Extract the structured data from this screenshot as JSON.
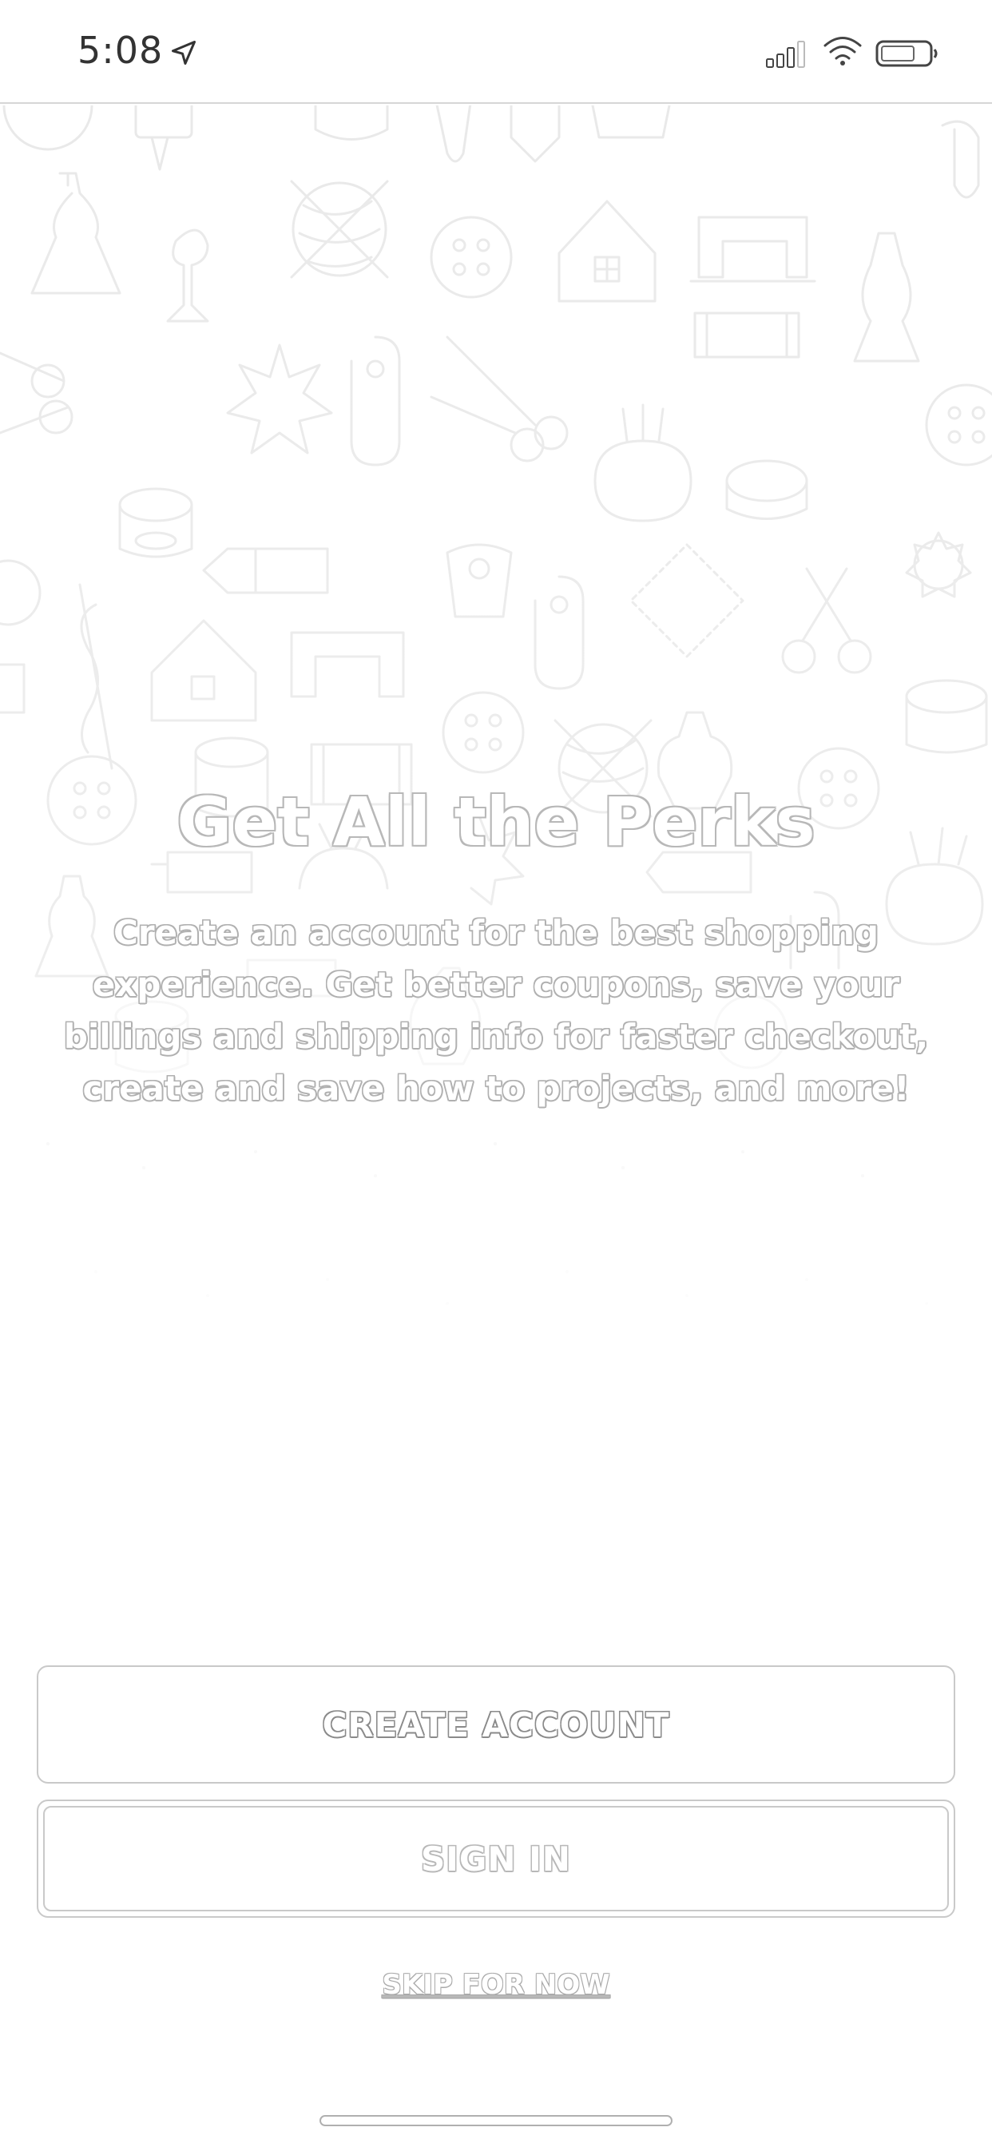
{
  "status_bar": {
    "time": "5:08",
    "icons": [
      "location-arrow-icon",
      "cellular-signal-icon",
      "wifi-icon",
      "battery-icon"
    ]
  },
  "background": {
    "pattern_icons": [
      "dress-form-icon",
      "yarn-ball-icon",
      "button-icon",
      "house-icon",
      "spool-icon",
      "scissors-icon",
      "safety-pin-icon",
      "pincushion-icon",
      "sewing-machine-icon",
      "fabric-roll-icon",
      "ruler-icon",
      "star-badge-icon"
    ]
  },
  "onboarding": {
    "title": "Get All the Perks",
    "description": "Create an account for the best shopping experience. Get better coupons, save your billings and shipping info for faster checkout, create and save how to projects, and more!"
  },
  "actions": {
    "create_account": "CREATE ACCOUNT",
    "sign_in": "SIGN IN",
    "skip": "SKIP FOR NOW"
  },
  "colors": {
    "background": "#ffffff",
    "outline": "#c9c9c9",
    "pattern_stroke": "#ebebeb"
  }
}
